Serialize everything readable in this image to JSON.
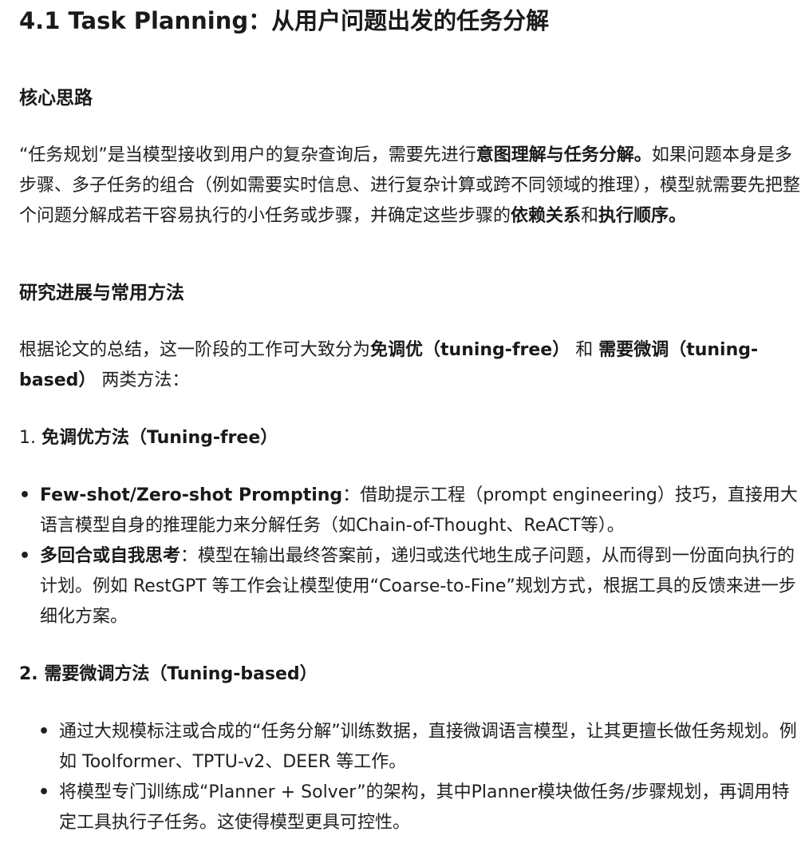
{
  "title": "4.1 Task Planning：从用户问题出发的任务分解",
  "core": {
    "heading": "核心思路",
    "intro": {
      "t1": "“任务规划”是当模型接收到用户的复杂查询后，需要先进行",
      "b1": "意图理解与任务分解。",
      "t2": "如果问题本身是多步骤、多子任务的组合（例如需要实时信息、进行复杂计算或跨不同领域的推理），模型就需要先把整个问题分解成若干容易执行的小任务或步骤，并确定这些步骤的",
      "b2": "依赖关系",
      "t3": "和",
      "b3": "执行顺序。"
    }
  },
  "research": {
    "heading": "研究进展与常用方法",
    "summary": {
      "t1": "根据论文的总结，这一阶段的工作可大致分为",
      "b1": "免调优（tuning-free）",
      "t2": " 和 ",
      "b2": "需要微调（tuning-based）",
      "t3": " 两类方法："
    }
  },
  "section1": {
    "number": "1. ",
    "title": "免调优方法（Tuning-free）",
    "items": [
      {
        "bold": "Few-shot/Zero-shot Prompting",
        "text": "：借助提示工程（prompt engineering）技巧，直接用大语言模型自身的推理能力来分解任务（如Chain-of-Thought、ReACT等）。"
      },
      {
        "bold": "多回合或自我思考",
        "text": "：模型在输出最终答案前，递归或迭代地生成子问题，从而得到一份面向执行的计划。例如 RestGPT 等工作会让模型使用“Coarse-to-Fine”规划方式，根据工具的反馈来进一步细化方案。"
      }
    ]
  },
  "section2": {
    "title": "2. 需要微调方法（Tuning-based）",
    "items": [
      {
        "text": "通过大规模标注或合成的“任务分解”训练数据，直接微调语言模型，让其更擅长做任务规划。例如 Toolformer、TPTU-v2、DEER 等工作。"
      },
      {
        "text": "将模型专门训练成“Planner + Solver”的架构，其中Planner模块做任务/步骤规划，再调用特定工具执行子任务。这使得模型更具可控性。"
      }
    ]
  },
  "bullet_char": "•"
}
